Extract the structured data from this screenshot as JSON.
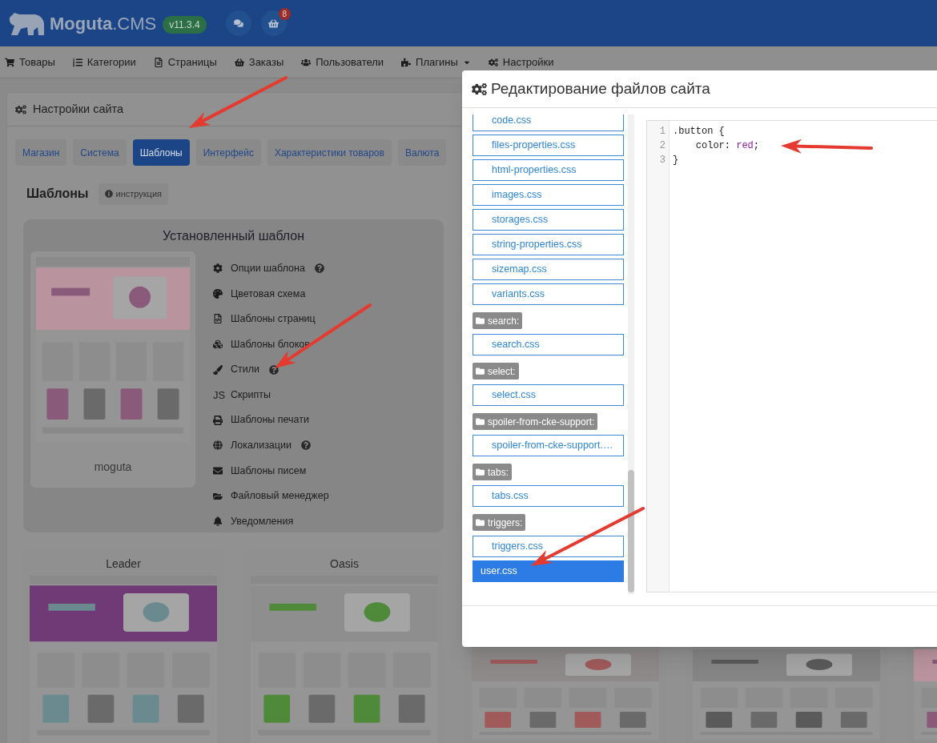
{
  "header": {
    "logo_name": "Moguta",
    "logo_suffix": ".CMS",
    "version": "v11.3.4",
    "cart_badge": "8"
  },
  "nav": [
    {
      "label": "Товары",
      "dropdown": false
    },
    {
      "label": "Категории",
      "dropdown": false
    },
    {
      "label": "Страницы",
      "dropdown": false
    },
    {
      "label": "Заказы",
      "dropdown": false
    },
    {
      "label": "Пользователи",
      "dropdown": false
    },
    {
      "label": "Плагины",
      "dropdown": true
    },
    {
      "label": "Настройки",
      "dropdown": false
    }
  ],
  "settings": {
    "title": "Настройки сайта",
    "tabs": [
      {
        "label": "Магазин",
        "selected": false
      },
      {
        "label": "Система",
        "selected": false
      },
      {
        "label": "Шаблоны",
        "selected": true
      },
      {
        "label": "Интерфейс",
        "selected": false
      },
      {
        "label": "Характеристики товаров",
        "selected": false
      },
      {
        "label": "Валюта",
        "selected": false
      }
    ],
    "section_title": "Шаблоны",
    "help_button": "инструкция",
    "installed": {
      "title": "Установленный шаблон",
      "name": "moguta",
      "menu": [
        {
          "label": "Опции шаблона",
          "help": true
        },
        {
          "label": "Цветовая схема",
          "help": false
        },
        {
          "label": "Шаблоны страниц",
          "help": false
        },
        {
          "label": "Шаблоны блоков",
          "help": false
        },
        {
          "label": "Стили",
          "help": true
        },
        {
          "label": "Скрипты",
          "help": false,
          "icon_text": "JS"
        },
        {
          "label": "Шаблоны печати",
          "help": false
        },
        {
          "label": "Локализации",
          "help": true
        },
        {
          "label": "Шаблоны писем",
          "help": false
        },
        {
          "label": "Файловый менеджер",
          "help": false
        },
        {
          "label": "Уведомления",
          "help": false
        }
      ]
    },
    "templates": [
      {
        "kind": "titled",
        "name": "Leader"
      },
      {
        "kind": "titled",
        "name": "Oasis"
      },
      {
        "kind": "covered"
      },
      {
        "kind": "covered"
      },
      {
        "kind": "covered"
      }
    ]
  },
  "modal": {
    "title": "Редактирование файлов сайта",
    "files": [
      {
        "kind": "file",
        "name": "code.css",
        "selected": false
      },
      {
        "kind": "file",
        "name": "files-properties.css",
        "selected": false
      },
      {
        "kind": "file",
        "name": "html-properties.css",
        "selected": false
      },
      {
        "kind": "file",
        "name": "images.css",
        "selected": false
      },
      {
        "kind": "file",
        "name": "storages.css",
        "selected": false
      },
      {
        "kind": "file",
        "name": "string-properties.css",
        "selected": false
      },
      {
        "kind": "file",
        "name": "sizemap.css",
        "selected": false
      },
      {
        "kind": "file",
        "name": "variants.css",
        "selected": false
      },
      {
        "kind": "folder",
        "name": "search:"
      },
      {
        "kind": "file",
        "name": "search.css",
        "selected": false
      },
      {
        "kind": "folder",
        "name": "select:"
      },
      {
        "kind": "file",
        "name": "select.css",
        "selected": false
      },
      {
        "kind": "folder",
        "name": "spoiler-from-cke-support:"
      },
      {
        "kind": "file",
        "name": "spoiler-from-cke-support.…",
        "selected": false
      },
      {
        "kind": "folder",
        "name": "tabs:"
      },
      {
        "kind": "file",
        "name": "tabs.css",
        "selected": false
      },
      {
        "kind": "folder",
        "name": "triggers:"
      },
      {
        "kind": "file",
        "name": "triggers.css",
        "selected": false
      },
      {
        "kind": "file",
        "name": "user.css",
        "selected": true
      }
    ],
    "editor": {
      "lines": [
        {
          "number": "1",
          "tokens": [
            {
              "kind": "plain",
              "text": ".button {"
            }
          ]
        },
        {
          "number": "2",
          "tokens": [
            {
              "kind": "plain",
              "text": "    color: "
            },
            {
              "kind": "keyword",
              "text": "red"
            },
            {
              "kind": "plain",
              "text": ";"
            }
          ]
        },
        {
          "number": "3",
          "tokens": [
            {
              "kind": "plain",
              "text": "}"
            }
          ]
        }
      ]
    }
  }
}
